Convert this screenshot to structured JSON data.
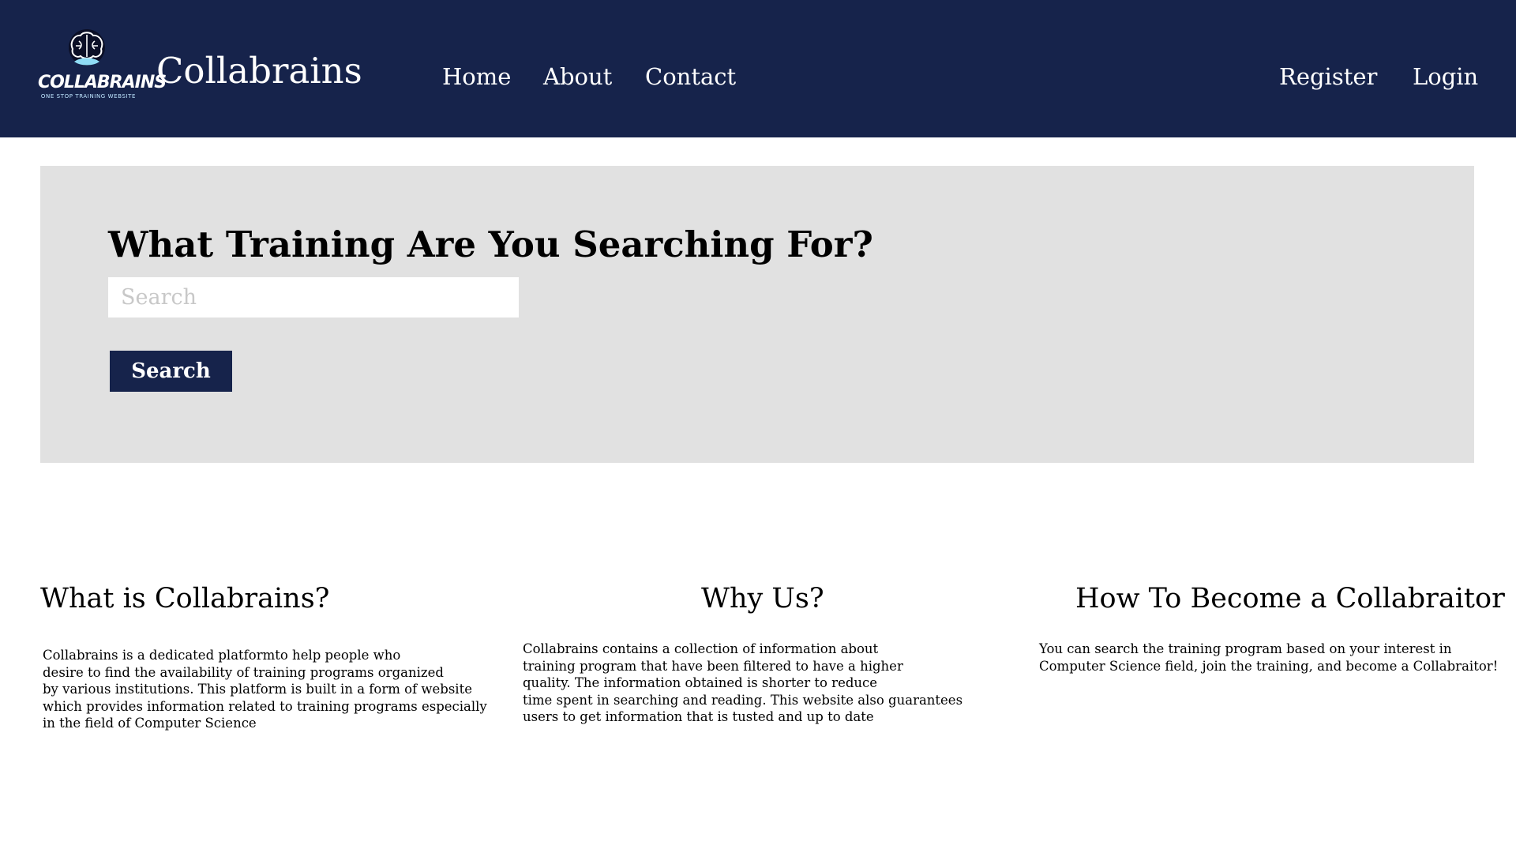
{
  "header": {
    "logo": {
      "icon": "brain-icon",
      "wordmark": "COLLABRAINS",
      "tagline": "ONE STOP TRAINING WEBSITE"
    },
    "brand": "Collabrains",
    "nav": {
      "home": "Home",
      "about": "About",
      "contact": "Contact"
    },
    "auth": {
      "register": "Register",
      "login": "Login"
    }
  },
  "hero": {
    "title": "What Training Are You Searching For?",
    "search_placeholder": "Search",
    "search_value": "",
    "search_button": "Search"
  },
  "info": [
    {
      "heading": "What is Collabrains?",
      "text": "Collabrains is a dedicated platformto help people who\ndesire to find the availability of training programs organized\nby various institutions. This platform is built in a form of website\nwhich provides information related to training programs especially\nin the field of Computer Science"
    },
    {
      "heading": "Why Us?",
      "text": "Collabrains contains a collection of information about\ntraining program that have been filtered to have a higher\nquality. The information obtained is shorter to reduce\ntime spent in searching and reading. This website also guarantees\nusers to get information that is tusted and up to date"
    },
    {
      "heading": "How To Become a Collabraitor",
      "text": "You can search the training program based on your interest in\nComputer Science field, join the training, and become a Collabraitor!"
    }
  ],
  "colors": {
    "navbar": "#16234b",
    "hero_bg": "#e1e1e1",
    "button": "#16234b",
    "logo_accent": "#8fdcf5"
  }
}
